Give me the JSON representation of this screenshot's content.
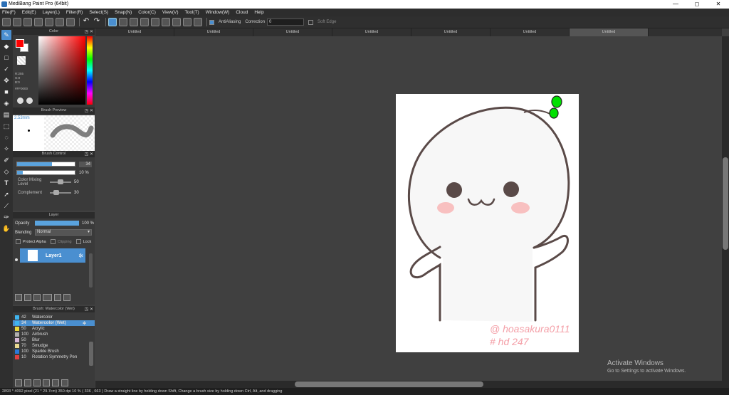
{
  "window": {
    "title": "MediBang Paint Pro (64bit)",
    "minimize": "—",
    "maximize": "◻",
    "close": "✕"
  },
  "menu": [
    "File(F)",
    "Edit(E)",
    "Layer(L)",
    "Filter(R)",
    "Select(S)",
    "Snap(N)",
    "Color(C)",
    "View(V)",
    "Tool(T)",
    "Window(W)",
    "Cloud",
    "Help"
  ],
  "toolbar": {
    "antialias_label": "AntiAliasing",
    "correction_label": "Correction",
    "correction_value": "0",
    "soft_edge_label": "Soft Edge"
  },
  "tabs": [
    "Untitled",
    "Untitled",
    "Untitled",
    "Untitled",
    "Untitled",
    "Untitled",
    "Untitled"
  ],
  "active_tab": 6,
  "color_panel": {
    "title": "Color",
    "primary": "#ff0000",
    "secondary": "#ffffff",
    "hsv": [
      "R:255",
      "G:0",
      "B:0"
    ],
    "hex": "#FF0000"
  },
  "brush_preview": {
    "title": "Brush Preview",
    "size": "2.53mm"
  },
  "brush_control": {
    "title": "Brush Control",
    "size_value": "34",
    "opacity_value": "10 %",
    "color_mixing_label": "Color Mixing Level",
    "color_mixing_value": "50",
    "complement_label": "Complement",
    "complement_value": "30",
    "size_level": 0.6,
    "opacity_level": 0.1,
    "color_mixing_level": 0.5,
    "complement_level": 0.3
  },
  "layer_panel": {
    "title": "Layer",
    "opacity_label": "Opacity",
    "opacity_value": "100 %",
    "blending_label": "Blending",
    "blending_value": "Normal",
    "protect_alpha": "Protect Alpha",
    "clipping": "Clipping",
    "lock": "Lock",
    "layer_name": "Layer1"
  },
  "brush_list": {
    "title": "Brush: Watercolor (Wet)",
    "items": [
      {
        "size": "42",
        "name": "Watercolor",
        "color": "#3fb4ee",
        "selected": false
      },
      {
        "size": "34",
        "name": "Watercolor (Wet)",
        "color": "#3fb4ee",
        "selected": true
      },
      {
        "size": "50",
        "name": "Acrylic",
        "color": "#e8d53a",
        "selected": false
      },
      {
        "size": "100",
        "name": "Airbrush",
        "color": "#b0b0b0",
        "selected": false
      },
      {
        "size": "50",
        "name": "Blur",
        "color": "#d8b8d8",
        "selected": false
      },
      {
        "size": "70",
        "name": "Smudge",
        "color": "#e8d890",
        "selected": false
      },
      {
        "size": "100",
        "name": "Sparkle Brush",
        "color": "#2a7ad8",
        "selected": false
      },
      {
        "size": "10",
        "name": "Rotation Symmetry Pen",
        "color": "#e04040",
        "selected": false
      }
    ]
  },
  "canvas": {
    "signature_line1": "@ hoasakura0111",
    "signature_line2": "# hd 247",
    "sprout_color": "#00e000",
    "blush_color": "#f8b8b8",
    "outline_color": "#5a4a48"
  },
  "statusbar": "2893 * 4092 pixel   (21 * 29.7cm)   350 dpi   10 %   ( 336 , 663 )   Draw a straight line by holding down Shift, Change a brush size by holding down Ctrl, Alt, and dragging",
  "watermark": {
    "line1": "Activate Windows",
    "line2": "Go to Settings to activate Windows."
  }
}
